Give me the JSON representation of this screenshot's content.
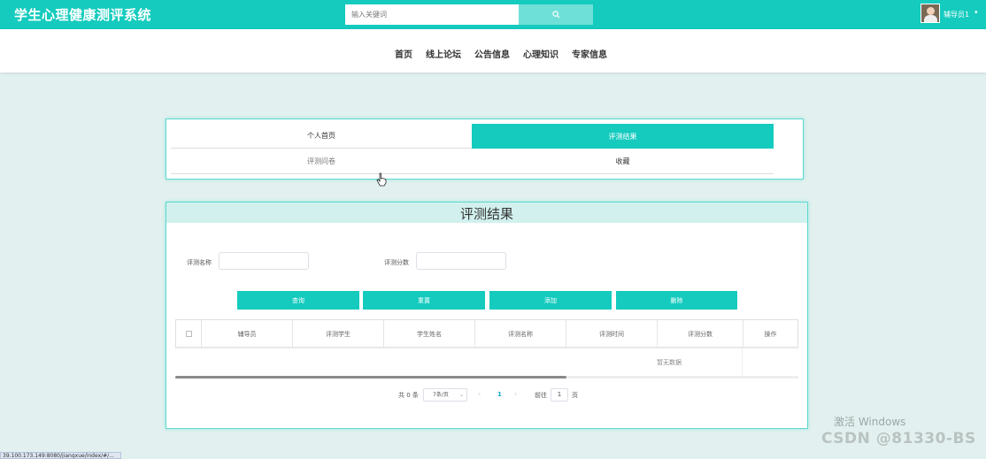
{
  "app": {
    "title": "学生心理健康测评系统"
  },
  "search": {
    "placeholder": "输入关键词",
    "icon": "search-icon"
  },
  "user": {
    "name": "辅导员1",
    "caret": "▾"
  },
  "nav": {
    "items": [
      "首页",
      "线上论坛",
      "公告信息",
      "心理知识",
      "专家信息"
    ]
  },
  "tabs": {
    "profile": "个人首页",
    "results": "评测结果",
    "questionnaire": "评测问卷",
    "favorites": "收藏"
  },
  "panel": {
    "title": "评测结果",
    "filters": {
      "name_label": "评测名称",
      "score_label": "评测分数"
    },
    "buttons": {
      "query": "查询",
      "reset": "重置",
      "add": "添加",
      "delete": "删除"
    },
    "table": {
      "columns": [
        "辅导员",
        "评测学生",
        "学生姓名",
        "评测名称",
        "评测时间",
        "评测分数",
        "操作"
      ],
      "empty_text": "暂无数据"
    },
    "pagination": {
      "total": "共 0 条",
      "page_size": "7条/页",
      "prev": "‹",
      "current_page": "1",
      "next": "›",
      "goto_label": "前往",
      "goto_value": "1",
      "page_unit": "页"
    }
  },
  "watermark": {
    "windows": "激活 Windows",
    "csdn": "CSDN @81330-BS"
  },
  "status_bar": {
    "url": "39.100.173.149:8080/jiangxue/index/#/..."
  },
  "colors": {
    "primary": "#14cbbe",
    "background": "#e2f1ef",
    "panel_header": "#d2f1ee"
  }
}
